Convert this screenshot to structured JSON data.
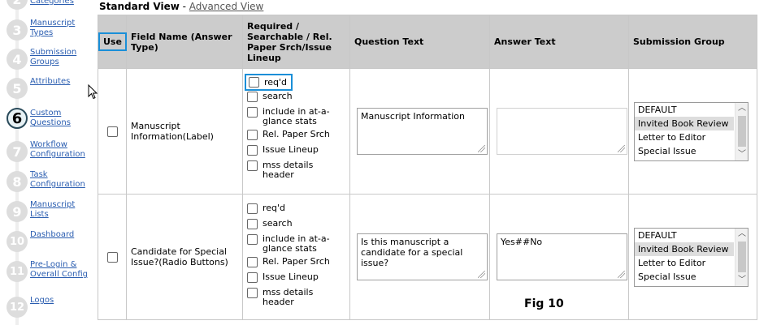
{
  "sidebar": {
    "steps": [
      {
        "number": "2",
        "label": "Categories"
      },
      {
        "number": "3",
        "label": "Manuscript Types"
      },
      {
        "number": "4",
        "label": "Submission Groups"
      },
      {
        "number": "5",
        "label": "Attributes"
      },
      {
        "number": "6",
        "label": "Custom Questions"
      },
      {
        "number": "7",
        "label": "Workflow Configuration"
      },
      {
        "number": "8",
        "label": "Task Configuration"
      },
      {
        "number": "9",
        "label": "Manuscript Lists"
      },
      {
        "number": "10",
        "label": "Dashboard"
      },
      {
        "number": "11",
        "label": "Pre-Login & Overall Config"
      },
      {
        "number": "12",
        "label": "Logos"
      }
    ]
  },
  "view": {
    "standard_label": "Standard View",
    "separator": " - ",
    "advanced_label": "Advanced View"
  },
  "table": {
    "headers": {
      "use": "Use",
      "field_name": "Field Name (Answer Type)",
      "required": "Required / Searchable / Rel. Paper Srch/Issue Lineup",
      "question": "Question Text",
      "answer": "Answer Text",
      "group": "Submission Group"
    },
    "option_labels": {
      "reqd": "req'd",
      "search": "search",
      "glance": "include in at-a-glance stats",
      "relpaper": "Rel. Paper Srch",
      "lineup": "Issue Lineup",
      "mss": "mss details header"
    },
    "group_options": [
      "DEFAULT",
      "Invited Book Review",
      "Letter to Editor",
      "Special Issue"
    ],
    "rows": [
      {
        "field_name": "Manuscript Information(Label)",
        "question_text": "Manuscript Information",
        "answer_text": ""
      },
      {
        "field_name": "Candidate for Special Issue?(Radio Buttons)",
        "question_text": "Is this manuscript a candidate for a special issue?",
        "answer_text": "Yes##No"
      }
    ]
  },
  "figure_label": "Fig 10",
  "colors": {
    "header_bg": "#cccccc",
    "highlight": "#1a8fd8",
    "link": "#2a5db0"
  }
}
